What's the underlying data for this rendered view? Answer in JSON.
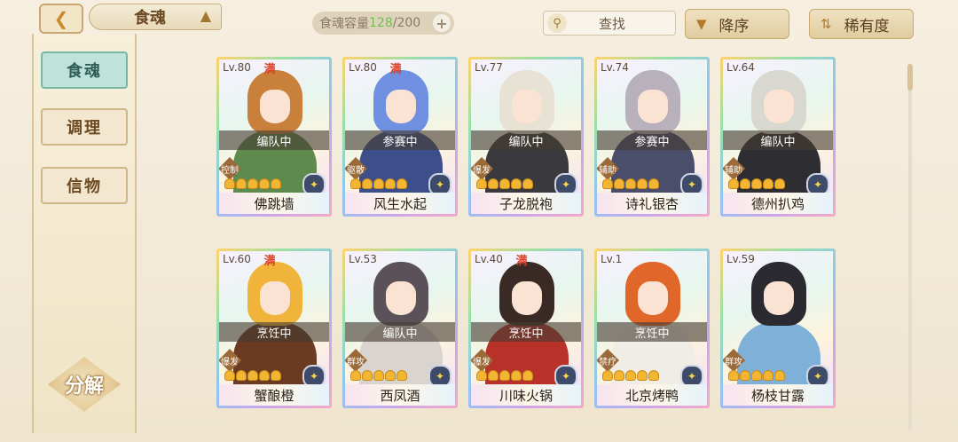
{
  "header": {
    "title": "食魂",
    "back_icon": "back-arrow-icon",
    "capacity_label": "食魂容量",
    "capacity_current": "128",
    "capacity_max": "/200",
    "plus_label": "+",
    "search_label": "查找",
    "sort_order_label": "降序",
    "sort_by_label": "稀有度"
  },
  "sidebar": {
    "tabs": [
      {
        "label": "食魂",
        "active": true
      },
      {
        "label": "调理",
        "active": false
      },
      {
        "label": "信物",
        "active": false
      }
    ],
    "decompose_label": "分解"
  },
  "cards": [
    {
      "level": "Lv.80",
      "max": "满",
      "status": "编队中",
      "role": "控制",
      "stars": 5,
      "name": "佛跳墙",
      "hair": "#c8803a",
      "body": "#5f8a4e"
    },
    {
      "level": "Lv.80",
      "max": "满",
      "status": "参赛中",
      "role": "驱散",
      "stars": 5,
      "name": "风生水起",
      "hair": "#6f8fe0",
      "body": "#3d4f8a"
    },
    {
      "level": "Lv.77",
      "max": "",
      "status": "编队中",
      "role": "爆发",
      "stars": 5,
      "name": "子龙脱袍",
      "hair": "#e8e2d4",
      "body": "#3a3a3e"
    },
    {
      "level": "Lv.74",
      "max": "",
      "status": "参赛中",
      "role": "辅助",
      "stars": 5,
      "name": "诗礼银杏",
      "hair": "#b8b0ba",
      "body": "#4a4e6a"
    },
    {
      "level": "Lv.64",
      "max": "",
      "status": "编队中",
      "role": "辅助",
      "stars": 5,
      "name": "德州扒鸡",
      "hair": "#d8d8d0",
      "body": "#2e2e32"
    },
    {
      "level": "Lv.60",
      "max": "满",
      "status": "烹饪中",
      "role": "爆发",
      "stars": 5,
      "name": "蟹酿橙",
      "hair": "#f0b43a",
      "body": "#6a3a22"
    },
    {
      "level": "Lv.53",
      "max": "",
      "status": "编队中",
      "role": "群攻",
      "stars": 5,
      "name": "西凤酒",
      "hair": "#5a5258",
      "body": "#d9d4d0"
    },
    {
      "level": "Lv.40",
      "max": "满",
      "status": "烹饪中",
      "role": "爆发",
      "stars": 5,
      "name": "川味火锅",
      "hair": "#3a2a26",
      "body": "#b8322a"
    },
    {
      "level": "Lv.1",
      "max": "",
      "status": "烹饪中",
      "role": "禁疗",
      "stars": 5,
      "name": "北京烤鸭",
      "hair": "#e0662a",
      "body": "#f0ede6"
    },
    {
      "level": "Lv.59",
      "max": "",
      "status": "",
      "role": "群攻",
      "stars": 5,
      "name": "杨枝甘露",
      "hair": "#2a2a30",
      "body": "#7fb0d8"
    }
  ]
}
